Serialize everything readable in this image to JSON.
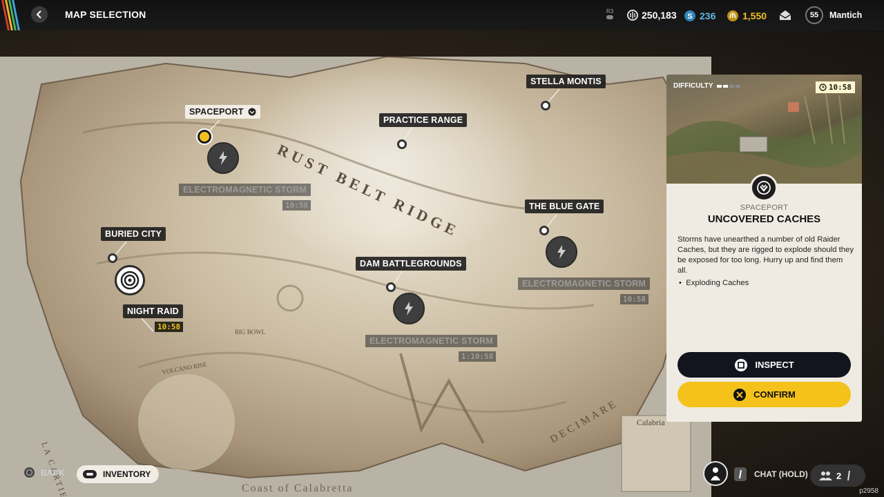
{
  "header": {
    "title": "MAP SELECTION",
    "r3_label": "R3",
    "coins": "250,183",
    "cred": "236",
    "raider_tokens": "1,550",
    "level": "55",
    "username": "Mantich"
  },
  "map": {
    "region_labels": [
      "RUST BELT RIDGE",
      "DECIMARE",
      "LA CARTIERA",
      "Coast of Calabretta",
      "Calabria",
      "VOLCANO RISE",
      "BIG BOWL"
    ],
    "locations": [
      {
        "name": "SPACEPORT",
        "selected": true
      },
      {
        "name": "PRACTICE RANGE"
      },
      {
        "name": "STELLA MONTIS"
      },
      {
        "name": "THE BLUE GATE"
      },
      {
        "name": "BURIED CITY"
      },
      {
        "name": "DAM BATTLEGROUNDS"
      }
    ],
    "events": {
      "storm_label": "ELECTROMAGNETIC STORM",
      "storm_timer_1": "10:58",
      "storm_timer_2": "10:58",
      "storm_timer_3": "1:10:58",
      "night_raid_label": "NIGHT RAID",
      "night_raid_timer": "10:58"
    }
  },
  "panel": {
    "difficulty_label": "DIFFICULTY",
    "difficulty_level": 2,
    "difficulty_max": 4,
    "timer": "10:58",
    "location": "SPACEPORT",
    "title": "UNCOVERED CACHES",
    "description": "Storms have unearthed a number of old Raider Caches, but they are rigged to explode should they be exposed for too long. Hurry up and find them all.",
    "bullet": "Exploding Caches",
    "inspect_label": "INSPECT",
    "confirm_label": "CONFIRM"
  },
  "footer": {
    "back_label": "BACK",
    "inventory_label": "INVENTORY",
    "chat_label": "CHAT (HOLD)",
    "party_count": "2",
    "version": "p2958"
  },
  "colors": {
    "accent_yellow": "#f4c21b",
    "panel_bg": "#efebe2",
    "dark_button": "#13151e"
  }
}
